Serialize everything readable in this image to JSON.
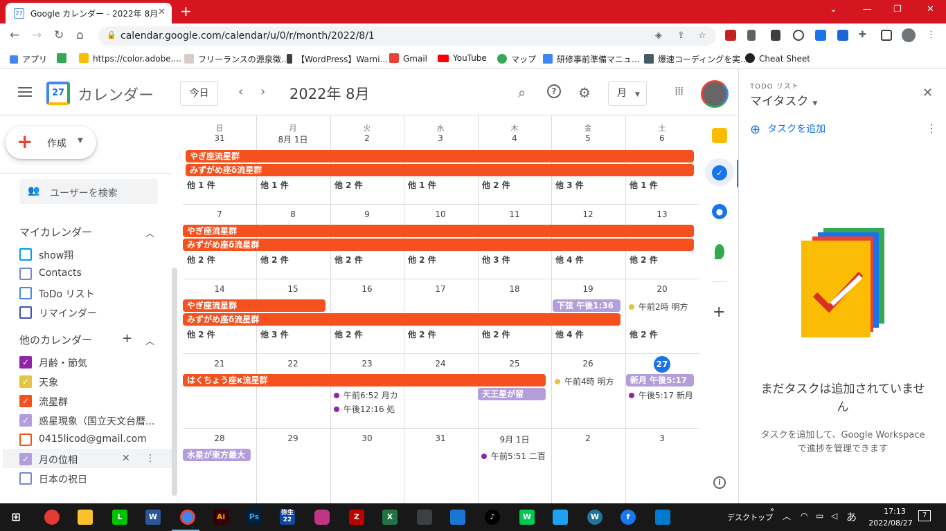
{
  "browser": {
    "tab_title": "Google カレンダー - 2022年 8月",
    "tab_favicon": "27",
    "url": "calendar.google.com/calendar/u/0/r/month/2022/8/1",
    "bookmarks": [
      "アプリ",
      "https://color.adobe....",
      "フリーランスの源泉徴...",
      "【WordPress】Warni...",
      "Gmail",
      "YouTube",
      "マップ",
      "研修事前準備マニュ...",
      "爆速コーディングを実...",
      "Cheat Sheet"
    ]
  },
  "header": {
    "app_title": "カレンダー",
    "icon_day": "27",
    "today": "今日",
    "month_title": "2022年 8月",
    "view": "月"
  },
  "sidebar": {
    "create": "作成",
    "search_users": "ユーザーを検索",
    "my_calendars_title": "マイカレンダー",
    "my_calendars": [
      {
        "name": "show翔",
        "color": "#039be5",
        "checked": false
      },
      {
        "name": "Contacts",
        "color": "#7986cb",
        "checked": false
      },
      {
        "name": "ToDo リスト",
        "color": "#4285f4",
        "checked": false
      },
      {
        "name": "リマインダー",
        "color": "#3f51b5",
        "checked": false
      }
    ],
    "other_calendars_title": "他のカレンダー",
    "other_calendars": [
      {
        "name": "月齢・節気",
        "color": "#8e24aa",
        "checked": true
      },
      {
        "name": "天象",
        "color": "#e4c441",
        "checked": true
      },
      {
        "name": "流星群",
        "color": "#f4511e",
        "checked": true
      },
      {
        "name": "惑星現象（国立天文台暦...",
        "color": "#b39ddb",
        "checked": true
      },
      {
        "name": "0415licod@gmail.com",
        "color": "#f4511e",
        "checked": false
      },
      {
        "name": "月の位相",
        "color": "#b39ddb",
        "checked": true
      },
      {
        "name": "日本の祝日",
        "color": "#7986cb",
        "checked": false
      }
    ]
  },
  "calendar": {
    "weekdays": [
      "日",
      "月",
      "火",
      "水",
      "木",
      "金",
      "土"
    ],
    "weeks": [
      {
        "days": [
          "31",
          "8月 1日",
          "2",
          "3",
          "4",
          "5",
          "6"
        ],
        "more": [
          "他 1 件",
          "他 1 件",
          "他 2 件",
          "他 1 件",
          "他 2 件",
          "他 3 件",
          "他 1 件"
        ]
      },
      {
        "days": [
          "7",
          "8",
          "9",
          "10",
          "11",
          "12",
          "13"
        ],
        "more": [
          "他 2 件",
          "他 2 件",
          "他 2 件",
          "他 2 件",
          "他 3 件",
          "他 4 件",
          "他 2 件"
        ]
      },
      {
        "days": [
          "14",
          "15",
          "16",
          "17",
          "18",
          "19",
          "20"
        ],
        "more": [
          "他 2 件",
          "他 3 件",
          "他 2 件",
          "他 2 件",
          "他 2 件",
          "他 4 件",
          "他 2 件"
        ]
      },
      {
        "days": [
          "21",
          "22",
          "23",
          "24",
          "25",
          "26",
          "27"
        ],
        "more": []
      },
      {
        "days": [
          "28",
          "29",
          "30",
          "31",
          "9月 1日",
          "2",
          "3"
        ],
        "more": []
      }
    ],
    "events": {
      "capricornids": "やぎ座流星群",
      "southern_delta_aquariids": "みずがめ座δ流星群",
      "last_quarter": "下弦 午後1:36",
      "moon_20": "午前2時 明方",
      "kappa_cygnids": "はくちょう座κ流星群",
      "e23a": "午前6:52 月カ",
      "e23b": "午後12:16 処",
      "uranus": "天王星が留",
      "moon_26": "午前4時 明方",
      "new_moon": "新月 午後5:17",
      "new_moon_dot": "午後5:17 新月",
      "mercury": "水星が東方最大",
      "sep1": "午前5:51 二百"
    }
  },
  "tasks": {
    "subtitle": "TODO リスト",
    "list_name": "マイタスク",
    "add_task": "タスクを追加",
    "empty_title": "まだタスクは追加されていません",
    "empty_body": "タスクを追加して、Google Workspace で進捗を管理できます"
  },
  "taskbar": {
    "desktop": "デスクトップ",
    "ime": "あ",
    "time": "17:13",
    "date": "2022/08/27",
    "notif": "7",
    "badge_yayoi": "弥生22"
  }
}
